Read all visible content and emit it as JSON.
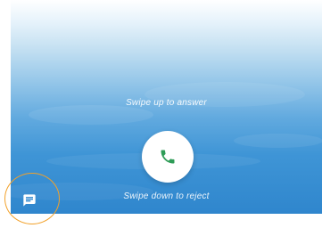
{
  "call": {
    "swipe_up_text": "Swipe up to answer",
    "swipe_down_text": "Swipe down to reject",
    "answer_icon": "phone-icon",
    "message_icon": "message-icon"
  },
  "colors": {
    "accent_green": "#2e9c57",
    "background_top": "#ffffff",
    "background_bottom": "#2f86cd",
    "highlight_ring": "#f2a12a"
  }
}
